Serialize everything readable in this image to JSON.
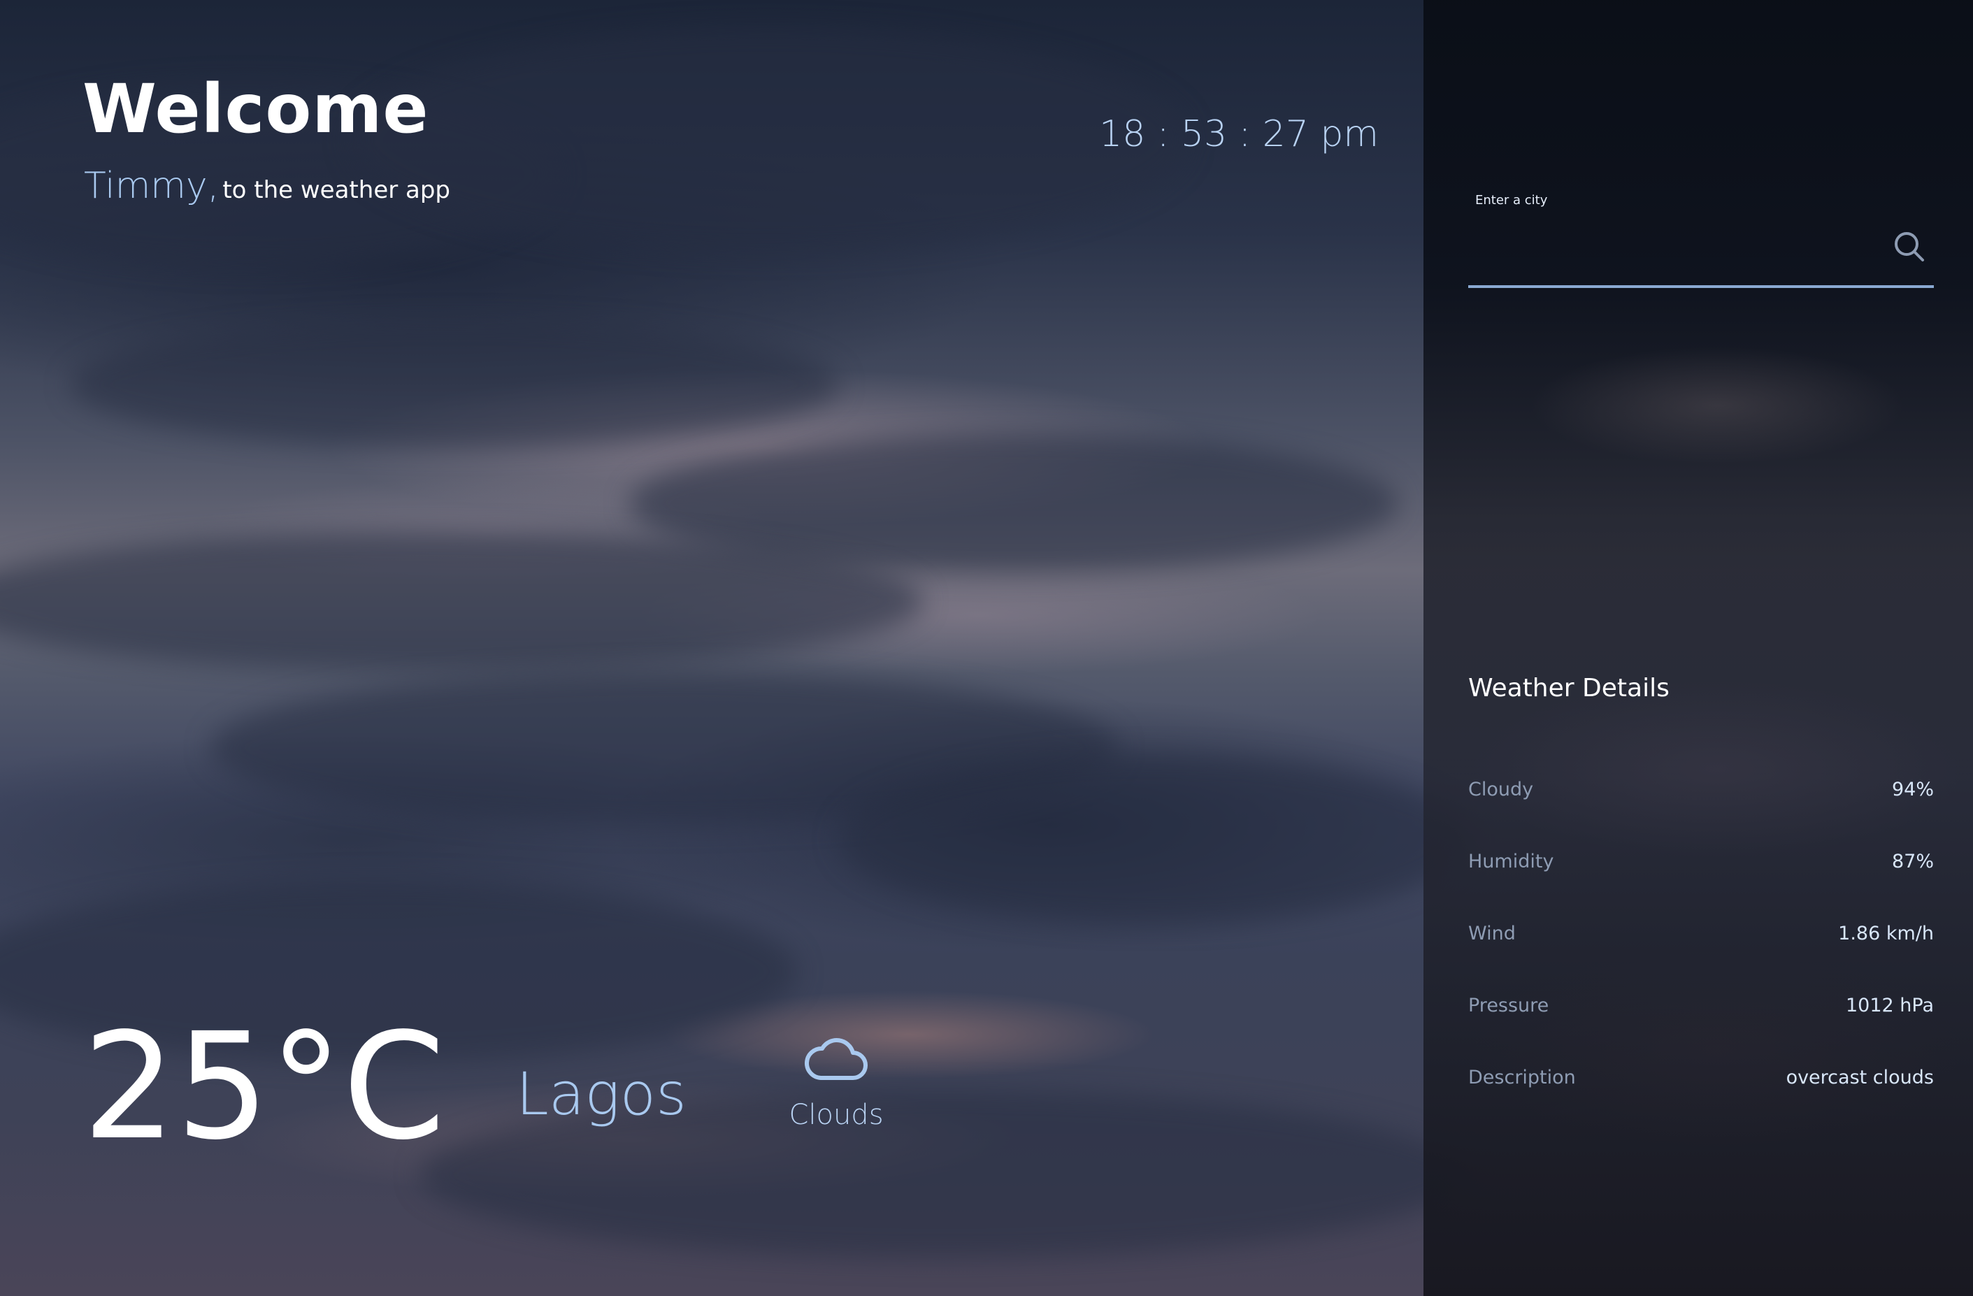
{
  "greeting": {
    "title": "Welcome",
    "user_name": "Timmy,",
    "subtitle": "to the weather app"
  },
  "clock": {
    "time": "18 : 53 : 27 pm"
  },
  "current": {
    "temperature": "25°C",
    "city": "Lagos",
    "condition": "Clouds",
    "condition_icon": "cloud-icon"
  },
  "search": {
    "label": "Enter a city",
    "value": "",
    "placeholder": "",
    "button_icon": "search-icon"
  },
  "details": {
    "title": "Weather Details",
    "rows": [
      {
        "label": "Cloudy",
        "value": "94%"
      },
      {
        "label": "Humidity",
        "value": "87%"
      },
      {
        "label": "Wind",
        "value": "1.86 km/h"
      },
      {
        "label": "Pressure",
        "value": "1012 hPa"
      },
      {
        "label": "Description",
        "value": "overcast clouds"
      }
    ]
  },
  "colors": {
    "accent": "#a9c9ef",
    "panel": "#0c1019",
    "underline": "#8aa9d2",
    "muted_label": "#8e9cb3"
  }
}
